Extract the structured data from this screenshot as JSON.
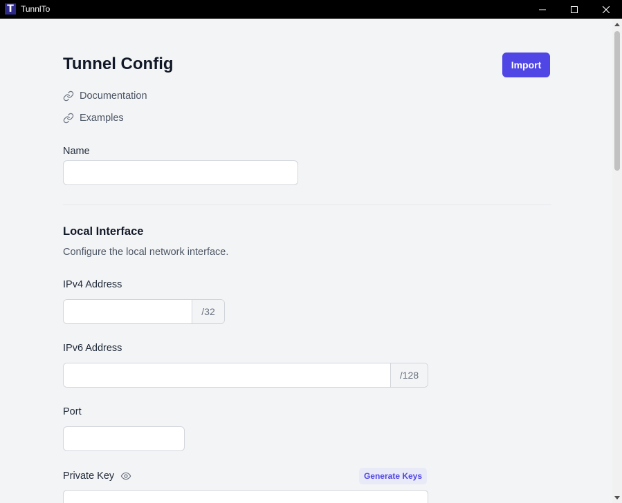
{
  "window": {
    "title": "TunnlTo",
    "logo_letter": "T",
    "controls": [
      "minimize",
      "maximize",
      "close"
    ]
  },
  "header": {
    "title": "Tunnel Config",
    "import_label": "Import"
  },
  "links": [
    {
      "label": "Documentation",
      "icon": "link-icon"
    },
    {
      "label": "Examples",
      "icon": "link-icon"
    }
  ],
  "name_field": {
    "label": "Name",
    "value": ""
  },
  "local_interface": {
    "title": "Local Interface",
    "description": "Configure the local network interface.",
    "ipv4": {
      "label": "IPv4 Address",
      "value": "",
      "suffix": "/32"
    },
    "ipv6": {
      "label": "IPv6 Address",
      "value": "",
      "suffix": "/128"
    },
    "port": {
      "label": "Port",
      "value": ""
    },
    "private_key": {
      "label": "Private Key",
      "icon": "eye-icon",
      "generate_label": "Generate Keys",
      "value": ""
    }
  },
  "colors": {
    "accent": "#4f46e5",
    "background": "#f3f4f6",
    "titlebar": "#000000"
  }
}
